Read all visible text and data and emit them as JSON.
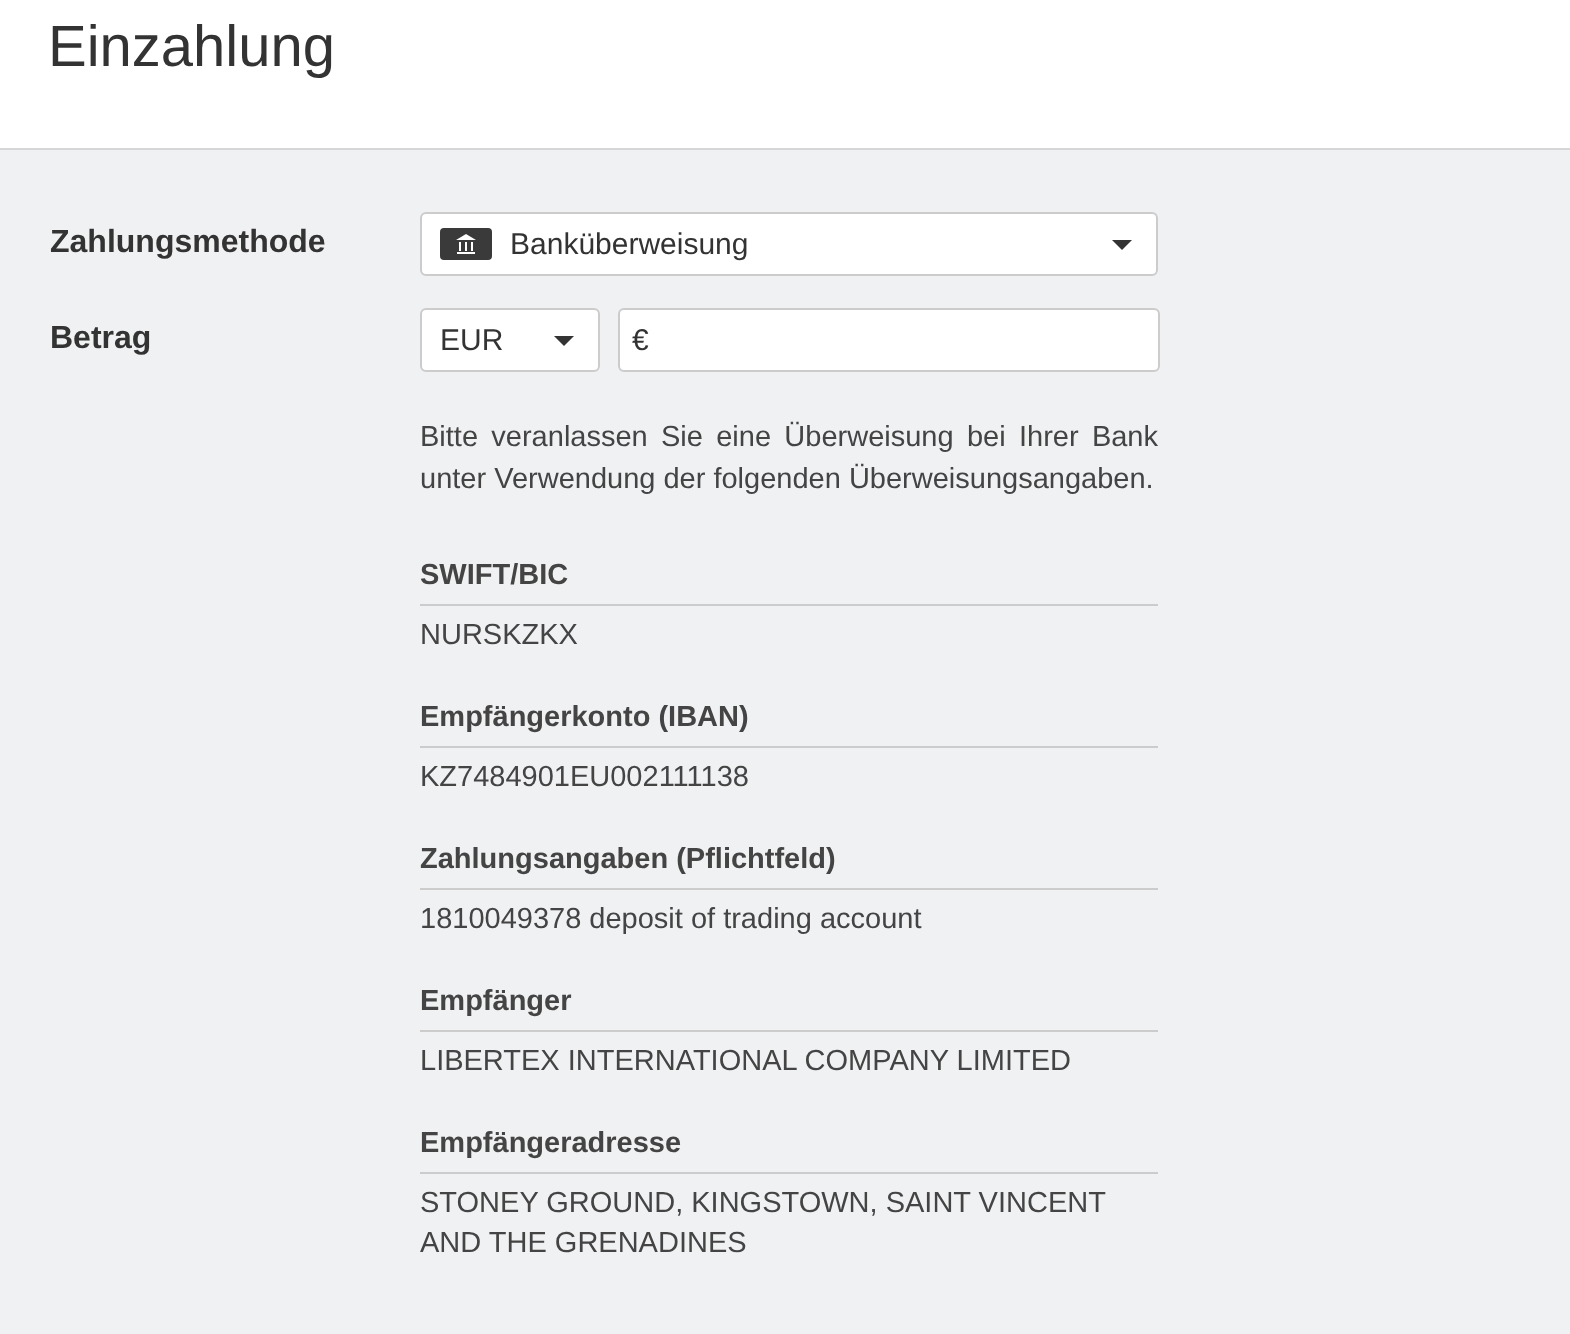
{
  "title": "Einzahlung",
  "payment_method": {
    "label": "Zahlungsmethode",
    "value": "Banküberweisung"
  },
  "amount": {
    "label": "Betrag",
    "currency": "EUR",
    "prefix": "€"
  },
  "instructions": "Bitte veranlassen Sie eine Überweisung bei Ihrer Bank unter Verwendung der folgenden Überweisungsangaben.",
  "details": [
    {
      "label": "SWIFT/BIC",
      "value": "NURSKZKX"
    },
    {
      "label": "Empfängerkonto (IBAN)",
      "value": "KZ7484901EU002111138"
    },
    {
      "label": "Zahlungsangaben (Pflichtfeld)",
      "value": "1810049378 deposit of trading account"
    },
    {
      "label": "Empfänger",
      "value": "LIBERTEX INTERNATIONAL COMPANY LIMITED"
    },
    {
      "label": "Empfängeradresse",
      "value": "STONEY GROUND, KINGSTOWN, SAINT VINCENT AND THE GRENADINES"
    }
  ]
}
